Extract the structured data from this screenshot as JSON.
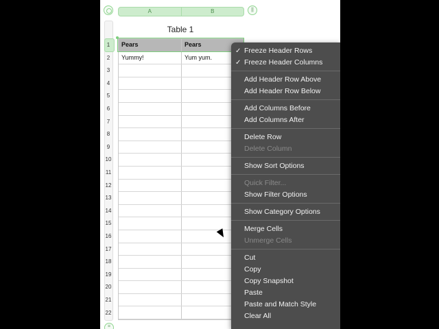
{
  "columns": [
    "A",
    "B"
  ],
  "table": {
    "title": "Table 1",
    "header": [
      "Pears",
      "Pears"
    ],
    "rows": [
      [
        "Yummy!",
        "Yum yum."
      ]
    ],
    "row_numbers": [
      "1",
      "2",
      "3",
      "4",
      "5",
      "6",
      "7",
      "8",
      "9",
      "10",
      "11",
      "12",
      "13",
      "14",
      "15",
      "16",
      "17",
      "18",
      "19",
      "20",
      "21",
      "22"
    ]
  },
  "context_menu": {
    "groups": [
      [
        {
          "label": "Freeze Header Rows",
          "checked": true,
          "enabled": true
        },
        {
          "label": "Freeze Header Columns",
          "checked": true,
          "enabled": true
        }
      ],
      [
        {
          "label": "Add Header Row Above",
          "enabled": true
        },
        {
          "label": "Add Header Row Below",
          "enabled": true
        }
      ],
      [
        {
          "label": "Add Columns Before",
          "enabled": true
        },
        {
          "label": "Add Columns After",
          "enabled": true
        }
      ],
      [
        {
          "label": "Delete Row",
          "enabled": true
        },
        {
          "label": "Delete Column",
          "enabled": false
        }
      ],
      [
        {
          "label": "Show Sort Options",
          "enabled": true
        }
      ],
      [
        {
          "label": "Quick Filter...",
          "enabled": false
        },
        {
          "label": "Show Filter Options",
          "enabled": true
        }
      ],
      [
        {
          "label": "Show Category Options",
          "enabled": true
        }
      ],
      [
        {
          "label": "Merge Cells",
          "enabled": true
        },
        {
          "label": "Unmerge Cells",
          "enabled": false
        }
      ],
      [
        {
          "label": "Cut",
          "enabled": true
        },
        {
          "label": "Copy",
          "enabled": true
        },
        {
          "label": "Copy Snapshot",
          "enabled": true
        },
        {
          "label": "Paste",
          "enabled": true
        },
        {
          "label": "Paste and Match Style",
          "enabled": true
        },
        {
          "label": "Clear All",
          "enabled": true
        }
      ]
    ],
    "checkmark": "✓"
  },
  "colors": {
    "selection_green": "#7ccf7c",
    "menu_bg": "#4d4d4d",
    "header_row": "#b7b7b7"
  }
}
